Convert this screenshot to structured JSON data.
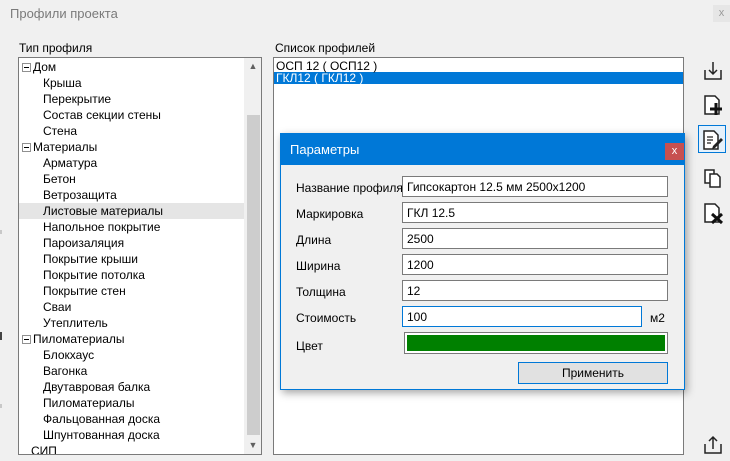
{
  "window": {
    "title": "Профили проекта",
    "close": "x"
  },
  "tree": {
    "caption": "Тип профиля",
    "items": [
      {
        "label": "Дом",
        "group": true
      },
      {
        "label": "Крыша"
      },
      {
        "label": "Перекрытие"
      },
      {
        "label": "Состав секции стены"
      },
      {
        "label": "Стена"
      },
      {
        "label": "Материалы",
        "group": true
      },
      {
        "label": "Арматура"
      },
      {
        "label": "Бетон"
      },
      {
        "label": "Ветрозащита"
      },
      {
        "label": "Листовые материалы",
        "selected": true
      },
      {
        "label": "Напольное покрытие"
      },
      {
        "label": "Пароизаляция"
      },
      {
        "label": "Покрытие крыши"
      },
      {
        "label": "Покрытие потолка"
      },
      {
        "label": "Покрытие стен"
      },
      {
        "label": "Сваи"
      },
      {
        "label": "Утеплитель"
      },
      {
        "label": "Пиломатериалы",
        "group": true
      },
      {
        "label": "Блокхаус"
      },
      {
        "label": "Вагонка"
      },
      {
        "label": "Двутавровая балка"
      },
      {
        "label": "Пиломатериалы"
      },
      {
        "label": "Фальцованная доска"
      },
      {
        "label": "Шпунтованная доска"
      },
      {
        "label": "СИП",
        "group": false,
        "top": true
      }
    ]
  },
  "profiles": {
    "caption": "Список профилей",
    "items": [
      {
        "label": "ОСП 12 ( ОСП12 )"
      },
      {
        "label": "ГКЛ12 ( ГКЛ12 )",
        "selected": true
      }
    ]
  },
  "toolbar": [
    {
      "name": "import-button",
      "icon": "import-icon"
    },
    {
      "name": "add-profile-button",
      "icon": "add-document-icon"
    },
    {
      "name": "edit-profile-button",
      "icon": "edit-document-icon",
      "active": true
    },
    {
      "name": "copy-profile-button",
      "icon": "copy-icon"
    },
    {
      "name": "delete-profile-button",
      "icon": "delete-document-icon"
    },
    {
      "name": "export-button",
      "icon": "export-icon"
    }
  ],
  "dialog": {
    "title": "Параметры",
    "close": "x",
    "fields": {
      "name": {
        "label": "Название профиля",
        "value": "Гипсокартон 12.5 мм 2500x1200"
      },
      "marking": {
        "label": "Маркировка",
        "value": "ГКЛ 12.5"
      },
      "length": {
        "label": "Длина",
        "value": "2500"
      },
      "width": {
        "label": "Ширина",
        "value": "1200"
      },
      "thickness": {
        "label": "Толщина",
        "value": "12"
      },
      "cost": {
        "label": "Стоимость",
        "value": "100",
        "unit": "м2"
      },
      "color": {
        "label": "Цвет",
        "value": "#008000"
      }
    },
    "apply": "Применить"
  },
  "colors": {
    "accent": "#0078d7",
    "close": "#c75050",
    "swatch": "#008000"
  }
}
